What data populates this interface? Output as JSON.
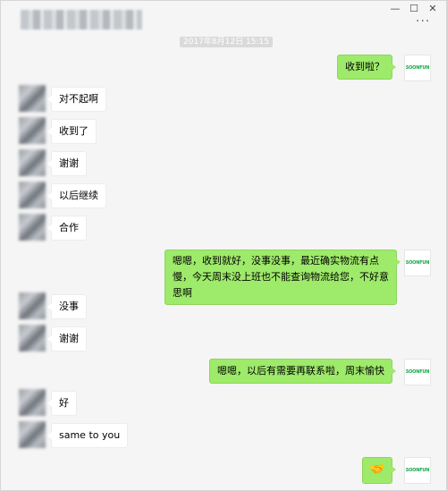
{
  "window": {
    "minimize_glyph": "—",
    "maximize_glyph": "☐",
    "close_glyph": "✕",
    "more_glyph": "···"
  },
  "timestamp": "2017年8月12日 15:15",
  "logo_text": "SOONFUN",
  "messages": [
    {
      "side": "out",
      "text": "收到啦？"
    },
    {
      "side": "in",
      "text": "对不起啊"
    },
    {
      "side": "in",
      "text": "收到了"
    },
    {
      "side": "in",
      "text": "谢谢"
    },
    {
      "side": "in",
      "text": "以后继续"
    },
    {
      "side": "in",
      "text": "合作"
    },
    {
      "side": "out",
      "text": "嗯嗯，收到就好，没事没事，最近确实物流有点慢，今天周末没上班也不能查询物流给您，不好意思啊"
    },
    {
      "side": "in",
      "text": "没事"
    },
    {
      "side": "in",
      "text": "谢谢"
    },
    {
      "side": "out",
      "text": "嗯嗯，以后有需要再联系啦，周末愉快"
    },
    {
      "side": "in",
      "text": "好"
    },
    {
      "side": "in",
      "text": "same to you"
    },
    {
      "side": "out",
      "emoji": "handshake-emoji"
    }
  ],
  "colors": {
    "background": "#f5f5f5",
    "outgoing_bubble": "#9eea6a",
    "incoming_bubble": "#ffffff",
    "logo_green": "#1aa64b"
  }
}
